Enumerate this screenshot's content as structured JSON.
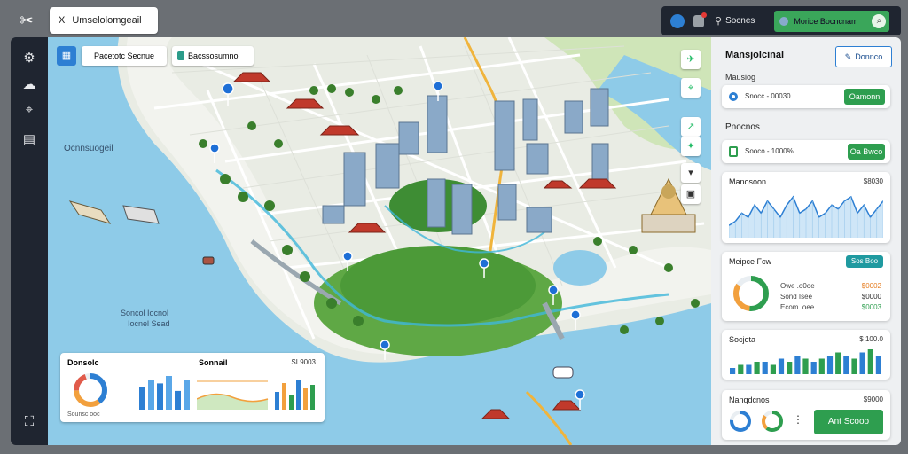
{
  "window": {
    "title": "Umselolomgeail",
    "close_glyph": "X"
  },
  "topbar": {
    "search_label": "Socnes",
    "action_label": "Morice Bocncnam"
  },
  "map": {
    "filter_chip_1": "Pacetotc Secnue",
    "filter_chip_2": "Bacssosumno",
    "label_west": "Ocnnsuogeil",
    "label_bay_1": "Soncol Iocnol",
    "label_bay_2": "Iocnel Sead",
    "colors": {
      "water": "#8ecbe8",
      "park": "#5fa845",
      "road": "#ffffff",
      "accent_route": "#3fb7d9"
    }
  },
  "map_overlay": {
    "title_left": "Donsolc",
    "title_right": "Sonnail",
    "value_right": "SL9003",
    "donut_caption": "Sounsc ooc"
  },
  "panel": {
    "title": "Mansjolcinal",
    "title_button": "Donnco",
    "section1_label": "Mausiog",
    "section1_value": "Snocc - 00030",
    "section1_button": "Oamonn",
    "section2_label": "Pnocnos",
    "section2_value": "Sooco - 1000%",
    "section2_button": "Oa Bwco",
    "chart1_title": "Manosoon",
    "chart1_value": "$8030",
    "donut_card_title": "Meipce Fcw",
    "donut_card_button": "Sos Boo",
    "donut_rows": [
      {
        "label": "Owe .o0oe",
        "value": "$0002"
      },
      {
        "label": "Sond Isee",
        "value": "$0000"
      },
      {
        "label": "Ecom .oee",
        "value": "$0003"
      }
    ],
    "bar_card_title": "Socjota",
    "bar_card_value": "$ 100.0",
    "bottom_card_title": "Nanqdcnos",
    "bottom_card_value": "$9000",
    "bottom_card_button": "Ant Scooo"
  },
  "chart_data": [
    {
      "type": "area",
      "title": "Manosoon",
      "values": [
        3,
        4,
        6,
        5,
        8,
        6,
        9,
        7,
        5,
        8,
        10,
        6,
        7,
        9,
        5,
        6,
        8,
        7,
        9,
        10,
        6,
        8,
        5,
        7,
        9
      ]
    },
    {
      "type": "bar",
      "title": "Socjota",
      "values": [
        2,
        3,
        3,
        4,
        4,
        3,
        5,
        4,
        6,
        5,
        4,
        5,
        6,
        7,
        6,
        5,
        7,
        8,
        6
      ]
    },
    {
      "type": "bar",
      "title": "Donsolc",
      "values": [
        6,
        8,
        7,
        9,
        5,
        8
      ]
    }
  ]
}
